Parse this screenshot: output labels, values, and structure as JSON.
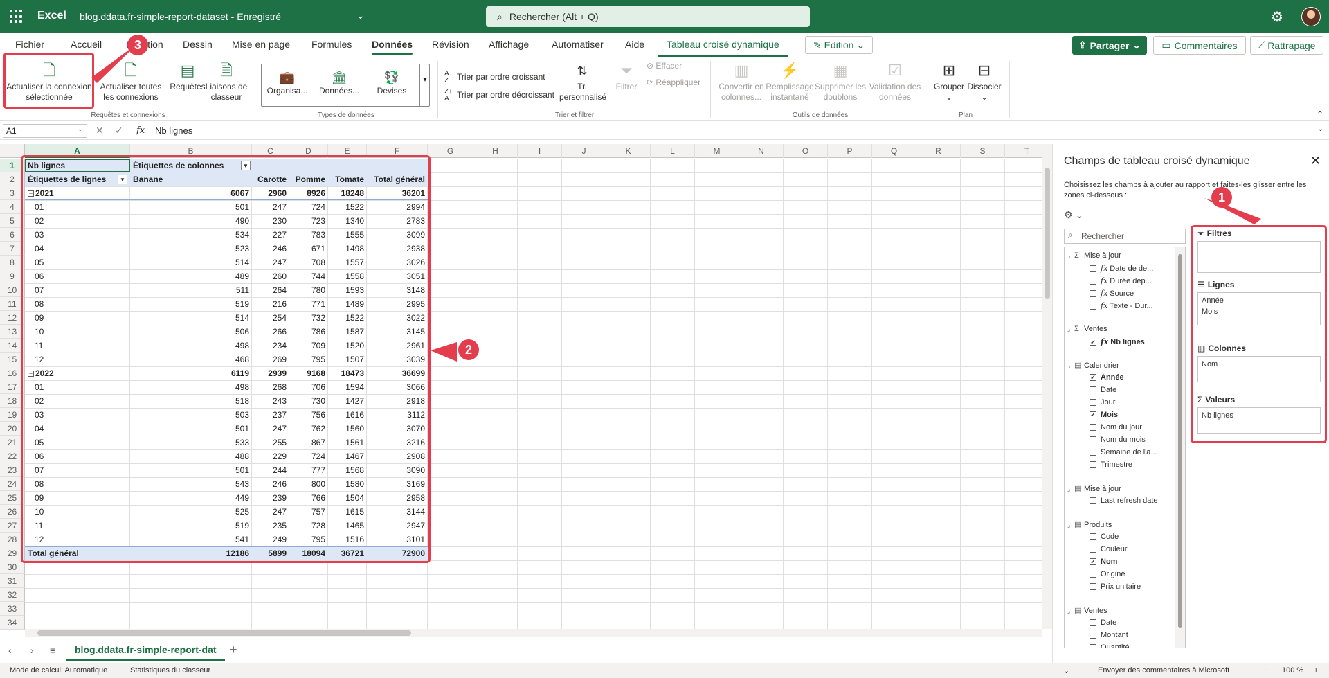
{
  "app": {
    "name": "Excel",
    "document_title": "blog.ddata.fr-simple-report-dataset",
    "save_status": "Enregistré",
    "search_placeholder": "Rechercher (Alt + Q)"
  },
  "menu_tabs": [
    {
      "label": "Fichier"
    },
    {
      "label": "Accueil"
    },
    {
      "label": "Insertion"
    },
    {
      "label": "Dessin"
    },
    {
      "label": "Mise en page"
    },
    {
      "label": "Formules"
    },
    {
      "label": "Données",
      "active": true
    },
    {
      "label": "Révision"
    },
    {
      "label": "Affichage"
    },
    {
      "label": "Automatiser"
    },
    {
      "label": "Aide"
    },
    {
      "label": "Tableau croisé dynamique",
      "contextual": true
    }
  ],
  "header_buttons": {
    "edition": "Edition",
    "share": "Partager",
    "comments": "Commentaires",
    "catch_up": "Rattrapage"
  },
  "ribbon": {
    "refresh_selected": "Actualiser la connexion sélectionnée",
    "refresh_all": "Actualiser toutes les connexions",
    "queries": "Requêtes",
    "workbook_links": "Liaisons de classeur",
    "group_queries": "Requêtes et connexions",
    "dt_organisation": "Organisa...",
    "dt_donnees": "Données...",
    "dt_devises": "Devises",
    "group_datatypes": "Types de données",
    "sort_asc": "Trier par ordre croissant",
    "sort_desc": "Trier par ordre décroissant",
    "custom_sort": "Tri personnalisé",
    "filter": "Filtrer",
    "clear": "Effacer",
    "reapply": "Réappliquer",
    "group_sort": "Trier et filtrer",
    "text_to_columns": "Convertir en colonnes...",
    "flash_fill": "Remplissage instantané",
    "remove_duplicates": "Supprimer les doublons",
    "data_validation": "Validation des données",
    "group_tools": "Outils de données",
    "group": "Grouper",
    "ungroup": "Dissocier",
    "group_outline": "Plan"
  },
  "formula_bar": {
    "name_box": "A1",
    "formula": "Nb lignes"
  },
  "grid": {
    "columns": [
      "A",
      "B",
      "C",
      "D",
      "E",
      "F",
      "G",
      "H",
      "I",
      "J",
      "K",
      "L",
      "M",
      "N",
      "O",
      "P",
      "Q",
      "R",
      "S",
      "T"
    ],
    "row_count": 34
  },
  "pivot": {
    "values_label": "Nb lignes",
    "column_labels": "Étiquettes de colonnes",
    "row_labels": "Étiquettes de lignes",
    "headers": [
      "Banane",
      "Carotte",
      "Pomme",
      "Tomate",
      "Total général"
    ],
    "rows": [
      {
        "label": "2021",
        "year": true,
        "values": [
          "6067",
          "2960",
          "8926",
          "18248",
          "36201"
        ]
      },
      {
        "label": "01",
        "values": [
          "501",
          "247",
          "724",
          "1522",
          "2994"
        ]
      },
      {
        "label": "02",
        "values": [
          "490",
          "230",
          "723",
          "1340",
          "2783"
        ]
      },
      {
        "label": "03",
        "values": [
          "534",
          "227",
          "783",
          "1555",
          "3099"
        ]
      },
      {
        "label": "04",
        "values": [
          "523",
          "246",
          "671",
          "1498",
          "2938"
        ]
      },
      {
        "label": "05",
        "values": [
          "514",
          "247",
          "708",
          "1557",
          "3026"
        ]
      },
      {
        "label": "06",
        "values": [
          "489",
          "260",
          "744",
          "1558",
          "3051"
        ]
      },
      {
        "label": "07",
        "values": [
          "511",
          "264",
          "780",
          "1593",
          "3148"
        ]
      },
      {
        "label": "08",
        "values": [
          "519",
          "216",
          "771",
          "1489",
          "2995"
        ]
      },
      {
        "label": "09",
        "values": [
          "514",
          "254",
          "732",
          "1522",
          "3022"
        ]
      },
      {
        "label": "10",
        "values": [
          "506",
          "266",
          "786",
          "1587",
          "3145"
        ]
      },
      {
        "label": "11",
        "values": [
          "498",
          "234",
          "709",
          "1520",
          "2961"
        ]
      },
      {
        "label": "12",
        "values": [
          "468",
          "269",
          "795",
          "1507",
          "3039"
        ]
      },
      {
        "label": "2022",
        "year": true,
        "values": [
          "6119",
          "2939",
          "9168",
          "18473",
          "36699"
        ]
      },
      {
        "label": "01",
        "values": [
          "498",
          "268",
          "706",
          "1594",
          "3066"
        ]
      },
      {
        "label": "02",
        "values": [
          "518",
          "243",
          "730",
          "1427",
          "2918"
        ]
      },
      {
        "label": "03",
        "values": [
          "503",
          "237",
          "756",
          "1616",
          "3112"
        ]
      },
      {
        "label": "04",
        "values": [
          "501",
          "247",
          "762",
          "1560",
          "3070"
        ]
      },
      {
        "label": "05",
        "values": [
          "533",
          "255",
          "867",
          "1561",
          "3216"
        ]
      },
      {
        "label": "06",
        "values": [
          "488",
          "229",
          "724",
          "1467",
          "2908"
        ]
      },
      {
        "label": "07",
        "values": [
          "501",
          "244",
          "777",
          "1568",
          "3090"
        ]
      },
      {
        "label": "08",
        "values": [
          "543",
          "246",
          "800",
          "1580",
          "3169"
        ]
      },
      {
        "label": "09",
        "values": [
          "449",
          "239",
          "766",
          "1504",
          "2958"
        ]
      },
      {
        "label": "10",
        "values": [
          "525",
          "247",
          "757",
          "1615",
          "3144"
        ]
      },
      {
        "label": "11",
        "values": [
          "519",
          "235",
          "728",
          "1465",
          "2947"
        ]
      },
      {
        "label": "12",
        "values": [
          "541",
          "249",
          "795",
          "1516",
          "3101"
        ]
      }
    ],
    "grand_total": {
      "label": "Total général",
      "values": [
        "12186",
        "5899",
        "18094",
        "36721",
        "72900"
      ]
    }
  },
  "sheet_tab": "blog.ddata.fr-simple-report-dat",
  "status_bar": {
    "calc_mode": "Mode de calcul: Automatique",
    "workbook_stats": "Statistiques du classeur",
    "feedback": "Envoyer des commentaires à Microsoft",
    "zoom": "100 %"
  },
  "pivot_pane": {
    "title": "Champs de tableau croisé dynamique",
    "description": "Choisissez les champs à ajouter au rapport et faites-les glisser entre les zones ci-dessous :",
    "search_placeholder": "Rechercher",
    "field_groups": [
      {
        "name": "Mise à jour",
        "icon": "sigma",
        "items": [
          {
            "label": "Date de de...",
            "fx": true,
            "checked": false
          },
          {
            "label": "Durée dep...",
            "fx": true,
            "checked": false
          },
          {
            "label": "Source",
            "fx": true,
            "checked": false
          },
          {
            "label": "Texte - Dur...",
            "fx": true,
            "checked": false
          }
        ]
      },
      {
        "name": "Ventes",
        "icon": "sigma",
        "items": [
          {
            "label": "Nb lignes",
            "fx": true,
            "checked": true
          }
        ]
      },
      {
        "name": "Calendrier",
        "icon": "table",
        "items": [
          {
            "label": "Année",
            "checked": true
          },
          {
            "label": "Date",
            "checked": false
          },
          {
            "label": "Jour",
            "checked": false
          },
          {
            "label": "Mois",
            "checked": true
          },
          {
            "label": "Nom du jour",
            "checked": false
          },
          {
            "label": "Nom du mois",
            "checked": false
          },
          {
            "label": "Semaine de l'a...",
            "checked": false
          },
          {
            "label": "Trimestre",
            "checked": false
          }
        ]
      },
      {
        "name": "Mise à jour",
        "icon": "table",
        "items": [
          {
            "label": "Last refresh date",
            "checked": false
          }
        ]
      },
      {
        "name": "Produits",
        "icon": "table",
        "items": [
          {
            "label": "Code",
            "checked": false
          },
          {
            "label": "Couleur",
            "checked": false
          },
          {
            "label": "Nom",
            "checked": true
          },
          {
            "label": "Origine",
            "checked": false
          },
          {
            "label": "Prix unitaire",
            "checked": false
          }
        ]
      },
      {
        "name": "Ventes",
        "icon": "table",
        "items": [
          {
            "label": "Date",
            "checked": false
          },
          {
            "label": "Montant",
            "checked": false
          },
          {
            "label": "Quantité",
            "checked": false
          }
        ]
      }
    ],
    "zones": {
      "filters_label": "Filtres",
      "filters": [],
      "rows_label": "Lignes",
      "rows": [
        "Année",
        "Mois"
      ],
      "columns_label": "Colonnes",
      "columns": [
        "Nom"
      ],
      "values_label": "Valeurs",
      "values": [
        "Nb lignes"
      ]
    }
  },
  "callouts": [
    "1",
    "2",
    "3"
  ],
  "colors": {
    "excel_green": "#1e7145",
    "callout_red": "#e43d4e",
    "pivot_band": "#dde7f5"
  }
}
